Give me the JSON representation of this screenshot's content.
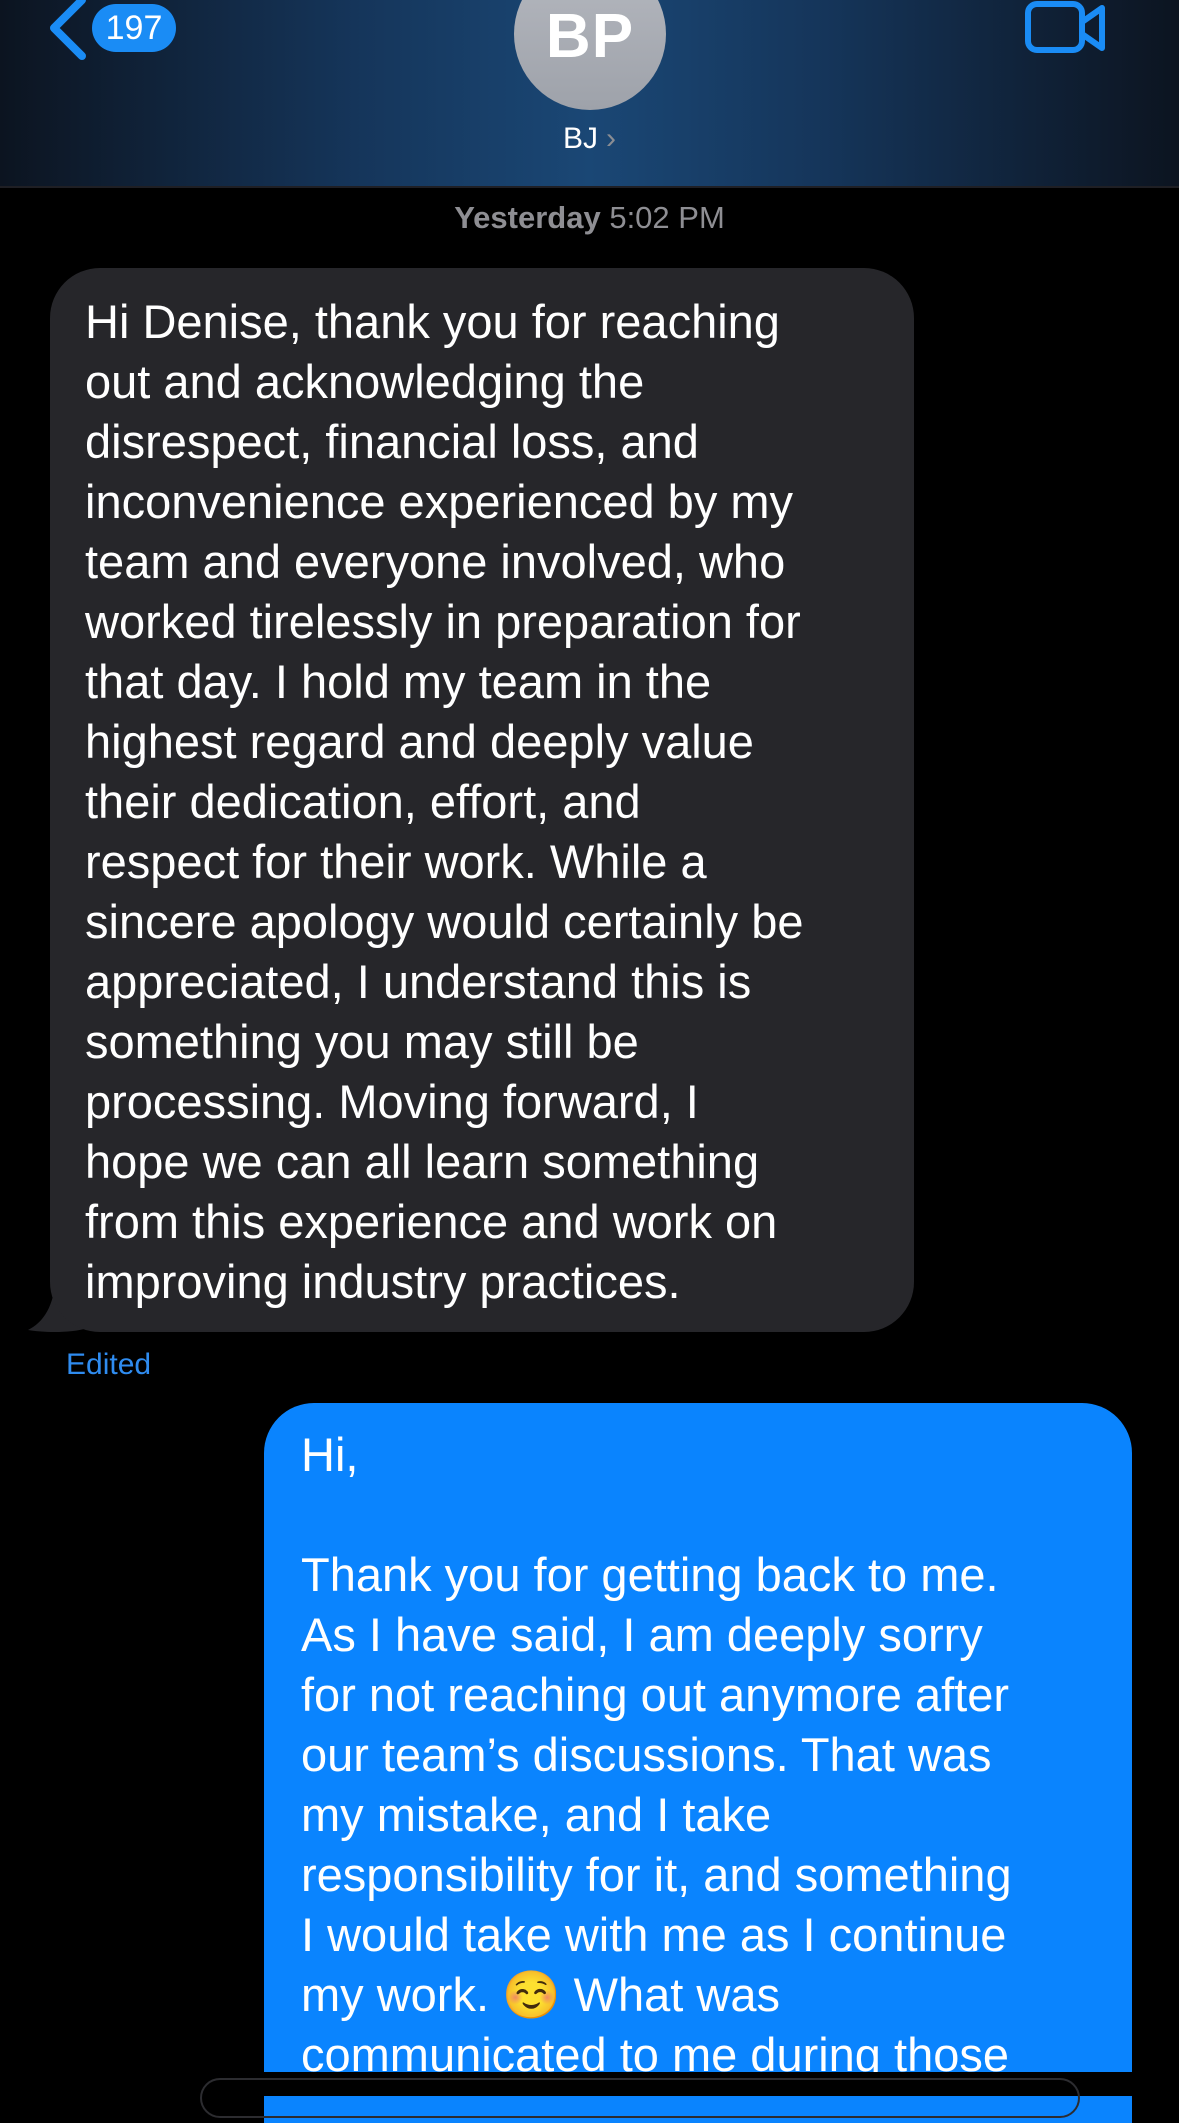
{
  "header": {
    "back_count": "197",
    "avatar_initials": "BP",
    "contact_name": "BJ",
    "contact_chevron": "›"
  },
  "icons": {
    "back": "chevron-left-icon",
    "video": "video-camera-icon",
    "contact": "chevron-right-icon"
  },
  "colors": {
    "accent": "#0a84fe",
    "incoming_bubble": "#26262a",
    "badge": "#1a8cf5"
  },
  "conversation": {
    "timestamp_day": "Yesterday",
    "timestamp_time": "5:02 PM",
    "incoming_message": "Hi Denise, thank you for reaching\nout and acknowledging the\ndisrespect, financial loss, and\ninconvenience experienced by my\nteam and everyone involved, who\nworked tirelessly in preparation for\nthat day. I hold my team in the\nhighest regard and deeply value\ntheir dedication, effort, and\nrespect for their work. While a\nsincere apology would certainly be\nappreciated, I understand this is\nsomething you may still be\nprocessing. Moving forward, I\nhope we can all learn something\nfrom this experience and work on\nimproving industry practices.",
    "incoming_status": "Edited",
    "outgoing_message": "Hi,\n\nThank you for getting back to me.\nAs I have said, I am deeply sorry\nfor not reaching out anymore after\nour team’s discussions. That was\nmy mistake, and I take\nresponsibility for it, and something\nI would take with me as I continue\nmy work. ☺️ What was\ncommunicated to me during those"
  }
}
